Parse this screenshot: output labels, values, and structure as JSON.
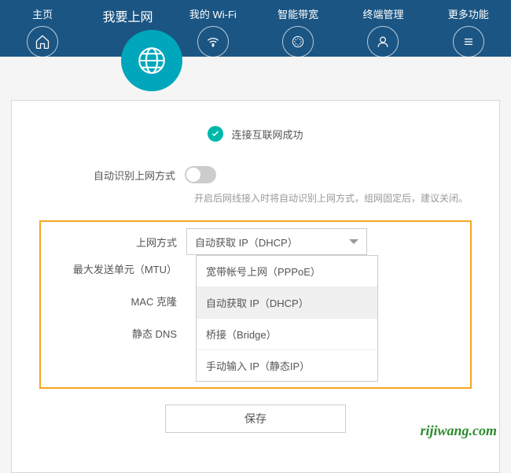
{
  "nav": {
    "items": [
      {
        "label": "主页",
        "icon": "home"
      },
      {
        "label": "我要上网",
        "icon": "globe",
        "active": true
      },
      {
        "label": "我的 Wi-Fi",
        "icon": "wifi"
      },
      {
        "label": "智能带宽",
        "icon": "bandwidth"
      },
      {
        "label": "终端管理",
        "icon": "user"
      },
      {
        "label": "更多功能",
        "icon": "menu"
      }
    ]
  },
  "status": {
    "text": "连接互联网成功"
  },
  "form": {
    "auto_detect_label": "自动识别上网方式",
    "auto_detect_hint": "开启后网线接入时将自动识别上网方式，组网固定后，建议关闭。",
    "connection_type_label": "上网方式",
    "mtu_label": "最大发送单元（MTU）",
    "mac_clone_label": "MAC 克隆",
    "static_dns_label": "静态 DNS",
    "connection_type_value": "自动获取 IP（DHCP）",
    "options": [
      "宽带帐号上网（PPPoE）",
      "自动获取 IP（DHCP）",
      "桥接（Bridge）",
      "手动输入 IP（静态IP）"
    ],
    "save_label": "保存"
  },
  "watermark": "rijiwang.com"
}
